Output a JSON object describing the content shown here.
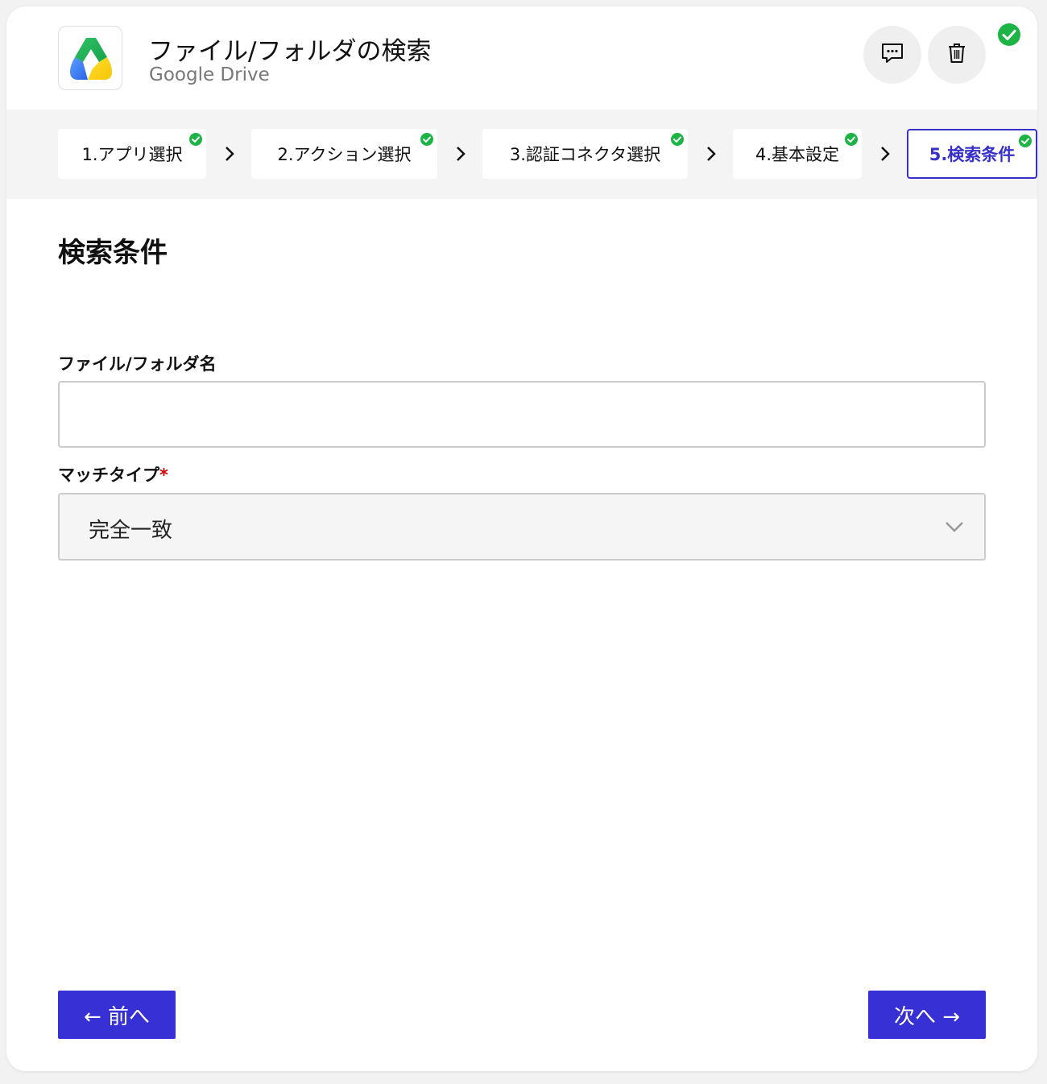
{
  "header": {
    "title": "ファイル/フォルダの検索",
    "subtitle": "Google Drive"
  },
  "icons": {
    "app": "google-drive-logo",
    "comment": "comment-icon",
    "trash": "trash-icon",
    "status": "check-circle-icon"
  },
  "steps": [
    {
      "label": "1.アプリ選択",
      "completed": true
    },
    {
      "label": "2.アクション選択",
      "completed": true
    },
    {
      "label": "3.認証コネクタ選択",
      "completed": true
    },
    {
      "label": "4.基本設定",
      "completed": true
    },
    {
      "label": "5.検索条件",
      "completed": true,
      "active": true
    }
  ],
  "section": {
    "title": "検索条件"
  },
  "form": {
    "name_label": "ファイル/フォルダ名",
    "name_value": "",
    "match_label": "マッチタイプ",
    "required_mark": "*",
    "match_value": "完全一致"
  },
  "footer": {
    "prev_label": "← 前へ",
    "next_label": "次へ →"
  },
  "colors": {
    "accent": "#3730d4",
    "success": "#1db446",
    "required": "#cc0000"
  }
}
